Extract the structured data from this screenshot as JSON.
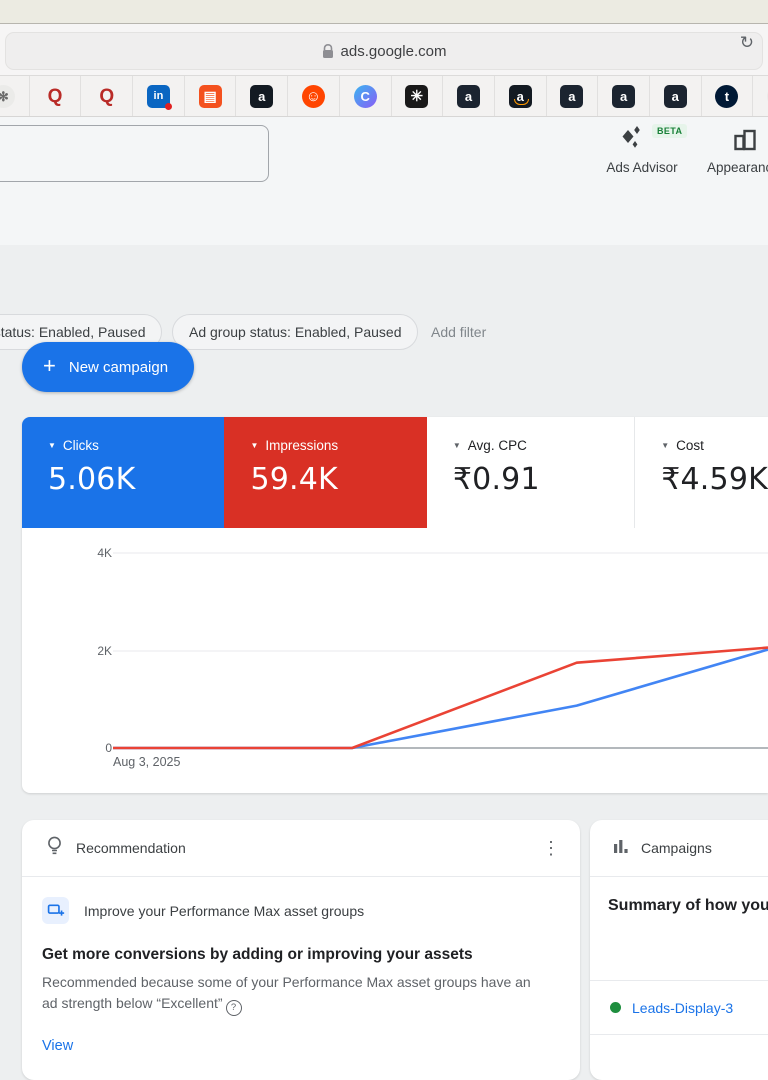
{
  "icons": {
    "caret": "▼",
    "kebab": "⋮",
    "reload": "↻",
    "plus": "+",
    "help": "?"
  },
  "browser": {
    "url": "ads.google.com",
    "bookmarks": [
      {
        "name": "chatgpt-favicon",
        "text": "✻",
        "fg": "#6b6b6b",
        "bg": "#ebebe9",
        "shape": "circle"
      },
      {
        "name": "quora-favicon",
        "text": "Q",
        "fg": "#b92b27",
        "bg": "transparent",
        "shape": "plain"
      },
      {
        "name": "quora-favicon-2",
        "text": "Q",
        "fg": "#b92b27",
        "bg": "transparent",
        "shape": "plain"
      },
      {
        "name": "linkedin-favicon",
        "text": "in",
        "fg": "#ffffff",
        "bg": "#0a66c2",
        "shape": "square",
        "fs": 11,
        "badge": "#e02020"
      },
      {
        "name": "reading-list-favicon",
        "text": "▤",
        "fg": "#ffffff",
        "bg": "#f4511e",
        "shape": "square",
        "fs": 14
      },
      {
        "name": "amazon-favicon",
        "text": "a",
        "fg": "#ffffff",
        "bg": "#131a22",
        "shape": "square"
      },
      {
        "name": "reddit-favicon",
        "text": "☺",
        "fg": "#ffffff",
        "bg": "#ff4500",
        "shape": "circle",
        "fs": 15
      },
      {
        "name": "c-app-favicon",
        "text": "C",
        "fg": "#ffffff",
        "bg": "linear-gradient(135deg,#3ab6f0,#8a5cf6)",
        "shape": "circle"
      },
      {
        "name": "dark-art-favicon",
        "text": "✳",
        "fg": "#ffffff",
        "bg": "#191919",
        "shape": "square",
        "fs": 15
      },
      {
        "name": "amazon-favicon-2",
        "text": "a",
        "fg": "#ffffff",
        "bg": "#1b2430",
        "shape": "square"
      },
      {
        "name": "amazon-smile-favicon",
        "text": "a",
        "fg": "#ffffff",
        "bg": "#131a22",
        "shape": "square",
        "smile": true
      },
      {
        "name": "amazon-favicon-3",
        "text": "a",
        "fg": "#ffffff",
        "bg": "#1b2430",
        "shape": "square"
      },
      {
        "name": "amazon-favicon-4",
        "text": "a",
        "fg": "#ffffff",
        "bg": "#1b2430",
        "shape": "square"
      },
      {
        "name": "amazon-favicon-5",
        "text": "a",
        "fg": "#ffffff",
        "bg": "#1b2430",
        "shape": "square"
      },
      {
        "name": "tumblr-favicon",
        "text": "t",
        "fg": "#ffffff",
        "bg": "#001935",
        "shape": "circle"
      },
      {
        "name": "chatgpt-favicon-2",
        "text": "✻",
        "fg": "#6b6b6b",
        "bg": "#ebebe9",
        "shape": "circle"
      }
    ]
  },
  "toolbar": {
    "ads_advisor_label": "Ads Advisor",
    "beta_badge": "BETA",
    "appearance_label": "Appearance"
  },
  "filters": {
    "chip_campaign_status": "Campaign status: Enabled, Paused",
    "chip_adgroup_status": "Ad group status: Enabled, Paused",
    "add_filter": "Add filter"
  },
  "actions": {
    "new_campaign": "New campaign",
    "accent_color": "#1a73e8"
  },
  "metric_cards": [
    {
      "label": "Clicks",
      "value": "5.06K",
      "bg": "#1a73e8",
      "fg": "#ffffff"
    },
    {
      "label": "Impressions",
      "value": "59.4K",
      "bg": "#d93025",
      "fg": "#ffffff"
    },
    {
      "label": "Avg. CPC",
      "value": "₹0.91",
      "bg": "#ffffff",
      "fg": "#202124"
    },
    {
      "label": "Cost",
      "value": "₹4.59K",
      "bg": "#ffffff",
      "fg": "#202124"
    }
  ],
  "chart_data": {
    "type": "line",
    "x_axis_first_label": "Aug 3, 2025",
    "y_ticks": [
      "4K",
      "2K",
      "0"
    ],
    "ylim": [
      0,
      4000
    ],
    "grid": "horizontal",
    "legend": "none (colors match Clicks/Impressions cards)",
    "x_fractions": [
      0,
      0.365,
      0.708,
      1.0
    ],
    "series": [
      {
        "name": "Clicks",
        "color": "#4285f4",
        "values": [
          0,
          0,
          870,
          2020
        ]
      },
      {
        "name": "Impressions",
        "color": "#ea4335",
        "values": [
          0,
          0,
          1750,
          2060
        ]
      }
    ]
  },
  "recommendation_card": {
    "title": "Recommendation",
    "item_label": "Improve your Performance Max asset groups",
    "heading": "Get more conversions by adding or improving your assets",
    "body": "Recommended because some of your Performance Max asset groups have an ad strength below “Excellent”",
    "link": "View"
  },
  "campaigns_card": {
    "title": "Campaigns",
    "summary": "Summary of how your",
    "row_label": "Leads-Display-3",
    "status_color": "#1e8e3e"
  }
}
